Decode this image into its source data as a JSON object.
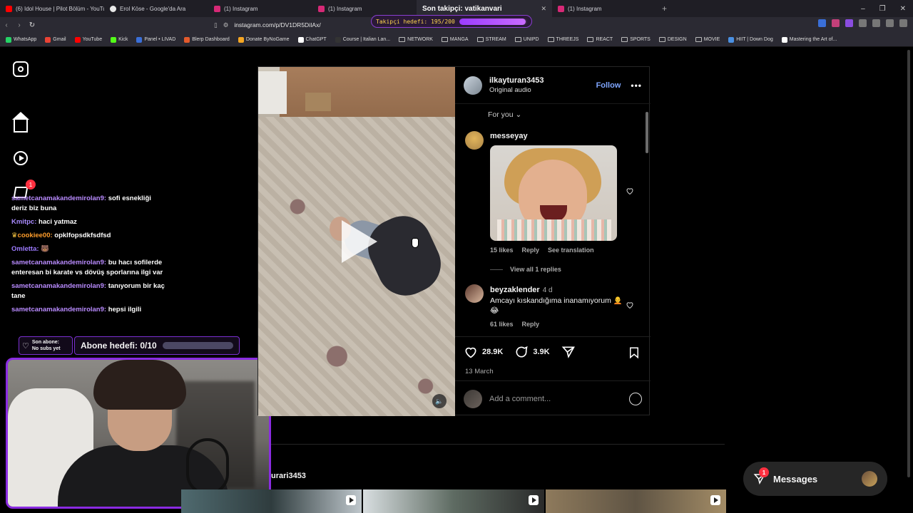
{
  "browser": {
    "tabs": [
      {
        "title": "(6) Idol House | Pilot Bölüm - YouTub",
        "color": "#ff0000"
      },
      {
        "title": "Erol Köse - Google'da Ara",
        "color": "#e8e8e8"
      },
      {
        "title": "(1) Instagram",
        "color": "#d62976"
      },
      {
        "title": "(1) Instagram",
        "color": "#d62976"
      },
      {
        "title": "Son takipçi: vatikanvari",
        "color": "#d62976"
      },
      {
        "title": "(1) Instagram",
        "color": "#d62976"
      }
    ],
    "url": "instagram.com/p/DV1DR5DiIAx/",
    "bookmarks": [
      "WhatsApp",
      "Gmail",
      "YouTube",
      "Kick",
      "Panel • LIVAD",
      "Blerp Dashboard",
      "Donate ByNoGame",
      "ChatGPT",
      "Course | Italian Lan...",
      "NETWORK",
      "MANGA",
      "STREAM",
      "UNIPD",
      "THREEJS",
      "REACT",
      "SPORTS",
      "DESIGN",
      "MOVIE",
      "HIIT | Down Dog",
      "Mastering the Art of..."
    ]
  },
  "stream": {
    "follow_goal": "Takipçi hedefi: 195/200",
    "follow_goal_progress": 0.975,
    "chat": [
      {
        "user": "sametcanamakandemirolan9:",
        "text": "sofi esnekliği deriz biz buna"
      },
      {
        "user": "Kmitpc:",
        "text": "haci yatmaz"
      },
      {
        "user": "cookiee00:",
        "text": "opklfopsdkfsdfsd"
      },
      {
        "user": "Omletta:",
        "text": ""
      },
      {
        "user": "sametcanamakandemirolan9:",
        "text": "bu hacı sofilerde enteresan bi karate vs dövüş sporlarına ilgi var"
      },
      {
        "user": "sametcanamakandemirolan9:",
        "text": "tanıyorum bir kaç tane"
      },
      {
        "user": "sametcanamakandemirolan9:",
        "text": "hepsi ilgili"
      }
    ],
    "last_sub_label": "Son abone:",
    "last_sub_value": "No subs yet",
    "sub_goal": "Abone hedefi: 0/10",
    "sub_goal_progress": 0.0,
    "notif_badge": "1"
  },
  "post": {
    "author": "ilkayturan3453",
    "audio": "Original audio",
    "follow": "Follow",
    "for_you": "For you",
    "comments": [
      {
        "user": "messeyay",
        "likes": "15 likes",
        "reply": "Reply",
        "translate": "See translation",
        "view_replies": "View all 1 replies"
      },
      {
        "user": "beyzaklender",
        "time": "4 d",
        "text": "Amcayı kıskandığıma inanamıyorum 🧑‍🦲😂",
        "likes": "61 likes",
        "reply": "Reply"
      }
    ],
    "like_count": "28.9K",
    "comment_count": "3.9K",
    "date": "13 March",
    "add_comment_placeholder": "Add a comment...",
    "more_from": "urari3453"
  },
  "messages": {
    "label": "Messages",
    "badge": "1"
  }
}
